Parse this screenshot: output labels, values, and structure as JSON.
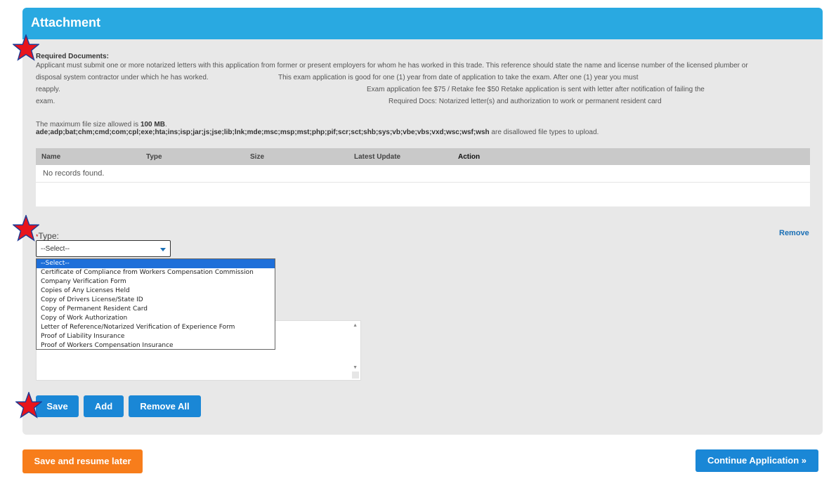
{
  "panel": {
    "title": "Attachment"
  },
  "required_docs": {
    "title": "Required Documents:",
    "line1": "Applicant must submit one or more notarized letters with this application from former or present employers for whom he has worked in this trade.  This reference should state the name and license number of the licensed plumber or",
    "line2a": "disposal system contractor under which he has worked.",
    "line2b": "This exam application is good for one (1) year from date of application to take the exam.  After one (1) year you must",
    "line3a": "reapply.",
    "line3b": "Exam application fee $75 / Retake fee $50  Retake application is sent with letter after notification of failing the",
    "line4a": "exam.",
    "line4b": "Required Docs:  Notarized letter(s) and authorization to work or permanent resident card"
  },
  "file_info": {
    "max_size_prefix": "The maximum file size allowed is ",
    "max_size_value": "100 MB",
    "max_size_suffix": ".",
    "disallowed_types": "ade;adp;bat;chm;cmd;com;cpl;exe;hta;ins;isp;jar;js;jse;lib;lnk;mde;msc;msp;mst;php;pif;scr;sct;shb;sys;vb;vbe;vbs;vxd;wsc;wsf;wsh",
    "disallowed_suffix": " are disallowed file types to upload."
  },
  "table": {
    "headers": [
      "Name",
      "Type",
      "Size",
      "Latest Update",
      "Action"
    ],
    "empty_message": "No records found."
  },
  "form": {
    "type_required_marker": "*",
    "type_label": "Type:",
    "remove_label": "Remove",
    "select_value": "--Select--",
    "options": [
      "--Select--",
      "Certificate of Compliance from Workers Compensation Commission",
      "Company Verification Form",
      "Copies of Any Licenses Held",
      "Copy of Drivers License/State ID",
      "Copy of Permanent Resident Card",
      "Copy of Work Authorization",
      "Letter of Reference/Notarized Verification of Experience Form",
      "Proof of Liability Insurance",
      "Proof of Workers Compensation Insurance"
    ]
  },
  "buttons": {
    "save": "Save",
    "add": "Add",
    "remove_all": "Remove All",
    "save_resume": "Save and resume later",
    "continue": "Continue Application »"
  },
  "colors": {
    "header": "#29a9e1",
    "primary_button": "#1a87d6",
    "secondary_button": "#f77d1b",
    "star_marker": "#e8141c"
  }
}
